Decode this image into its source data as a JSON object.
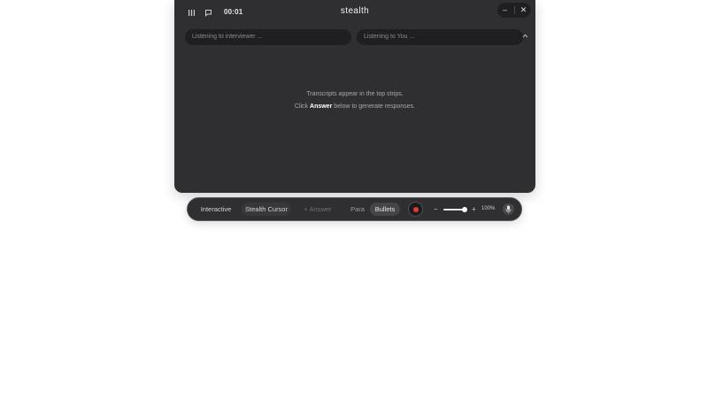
{
  "titlebar": {
    "timer": "00:01",
    "brand": "stealth",
    "left_icons": [
      "equalizer-icon",
      "chat-icon"
    ],
    "minimize_label": "–",
    "close_label": "✕"
  },
  "transcript": {
    "interviewer_placeholder": "Listening to interviewer ...",
    "you_placeholder": "Listening to You ...",
    "collapse_icon": "chevron-up-icon"
  },
  "main": {
    "hint_line1": "Transcripts appear in the top strips.",
    "hint_line2_prefix": "Click ",
    "hint_line2_bold": "Answer",
    "hint_line2_suffix": " below to generate responses."
  },
  "toolbar": {
    "interactive_label": "Interactive",
    "stealth_cursor_label": "Stealth Cursor",
    "answer_label": "+ Answer",
    "para_label": "Para",
    "bullets_label": "Bullets",
    "zoom_minus": "−",
    "zoom_plus": "+",
    "zoom_level": "100%",
    "zoom_value": 0.9,
    "record_color": "#e53935"
  },
  "colors": {
    "panel_bg": "#2f2f31",
    "strip_bg": "#1f1f21",
    "record": "#e53935"
  }
}
